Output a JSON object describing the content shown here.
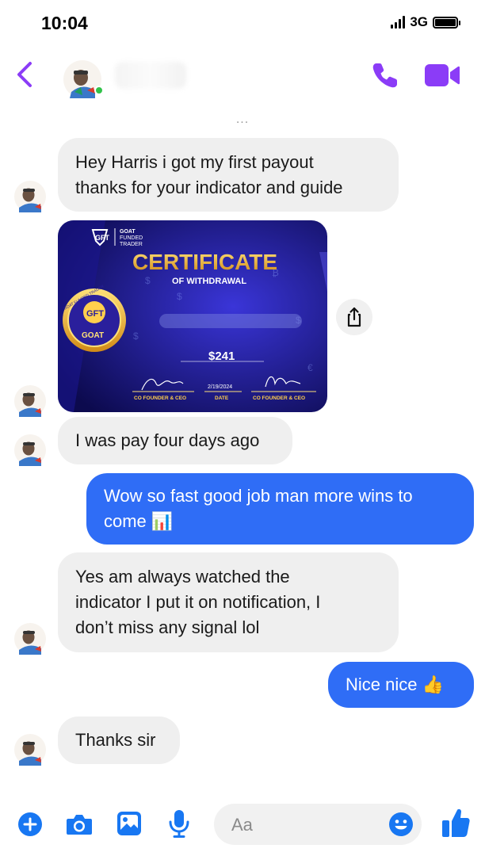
{
  "status_bar": {
    "time": "10:04",
    "network": "3G",
    "signal_bars": 4
  },
  "header": {
    "contact_name": "",
    "online": true
  },
  "thread": {
    "dots": "...",
    "messages": [
      {
        "id": "m1",
        "direction": "in",
        "lines": [
          "Hey Harris i got my first payout",
          "thanks for your indicator and guide"
        ]
      },
      {
        "id": "m2",
        "direction": "in",
        "type": "image",
        "image": {
          "brand": [
            "GOAT",
            "FUNDED",
            "TRADER"
          ],
          "title": "CERTIFICATE",
          "subtitle": "OF WITHDRAWAL",
          "amount": "$241",
          "date": "2/19/2024",
          "date_label": "DATE",
          "left_role": "CO FOUNDER & CEO",
          "right_role": "CO FOUNDER & CEO",
          "seal_text": "GOAT",
          "seal_ring": "GOAT FUNDED TRADER"
        }
      },
      {
        "id": "m3",
        "direction": "in",
        "lines": [
          "I was pay four days ago"
        ]
      },
      {
        "id": "m4",
        "direction": "out",
        "lines": [
          "Wow so fast good job man more wins to",
          "come 📊"
        ]
      },
      {
        "id": "m5",
        "direction": "in",
        "lines": [
          "Yes am always watched the",
          "indicator I put it on notification, I",
          "don’t miss any signal lol"
        ]
      },
      {
        "id": "m6",
        "direction": "out",
        "lines": [
          "Nice nice 👍"
        ]
      },
      {
        "id": "m7",
        "direction": "in",
        "lines": [
          "Thanks sir"
        ]
      }
    ]
  },
  "composer": {
    "placeholder": "Aa"
  },
  "colors": {
    "accent": "#8b3cf7",
    "outgoing_bubble": "#2f6df6",
    "incoming_bubble": "#efefef",
    "composer_blue": "#1877f2"
  },
  "icons": [
    "back-chevron-icon",
    "phone-icon",
    "video-icon",
    "share-icon",
    "plus-icon",
    "camera-icon",
    "gallery-icon",
    "microphone-icon",
    "emoji-icon",
    "thumbs-up-icon"
  ]
}
